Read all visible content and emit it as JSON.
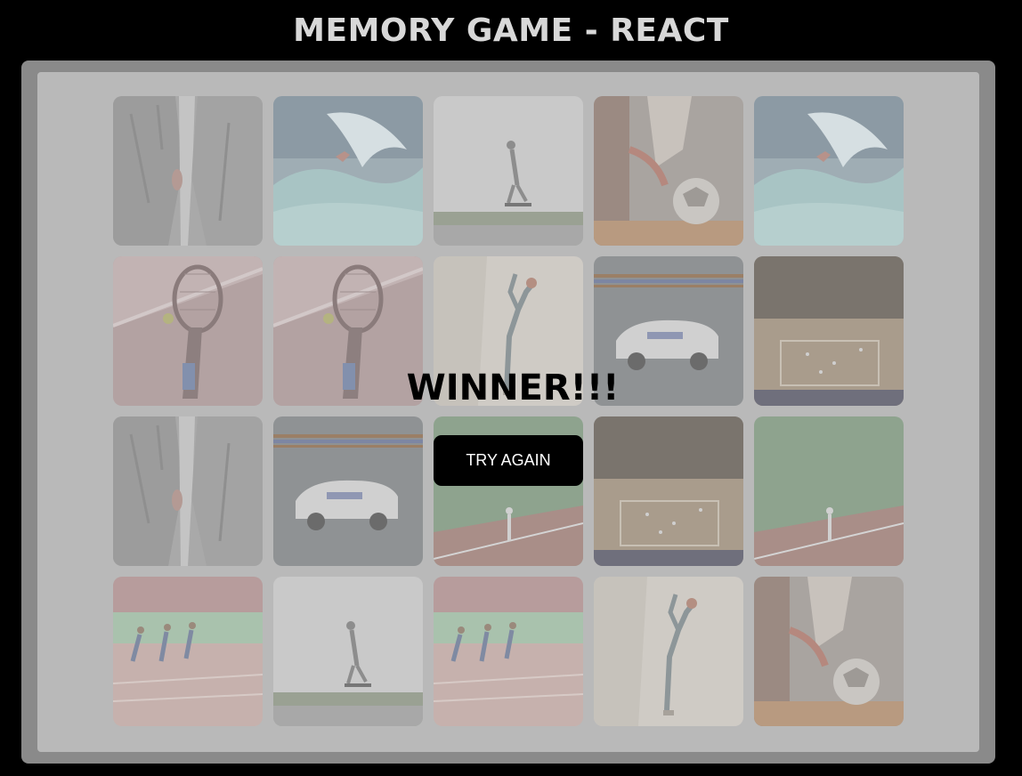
{
  "title": "MEMORY GAME - REACT",
  "result": {
    "message": "WINNER!!!",
    "button_label": "TRY AGAIN"
  },
  "cards": [
    {
      "image": "rock-climber"
    },
    {
      "image": "surfer-wave"
    },
    {
      "image": "skateboarder-jump"
    },
    {
      "image": "soccer-ball-kick"
    },
    {
      "image": "surfer-wave"
    },
    {
      "image": "tennis-racket"
    },
    {
      "image": "tennis-racket"
    },
    {
      "image": "yoga-pose"
    },
    {
      "image": "race-car"
    },
    {
      "image": "basketball-court"
    },
    {
      "image": "rock-climber"
    },
    {
      "image": "race-car"
    },
    {
      "image": "baseball-field"
    },
    {
      "image": "basketball-court"
    },
    {
      "image": "baseball-field"
    },
    {
      "image": "track-runners"
    },
    {
      "image": "skateboarder-jump"
    },
    {
      "image": "track-runners"
    },
    {
      "image": "yoga-pose"
    },
    {
      "image": "soccer-ball-kick"
    }
  ],
  "colors": {
    "background": "#000000",
    "board_frame": "#8a8a8a",
    "board_surface": "#b9b9b9",
    "title": "#d8d8d8",
    "button": "#000000",
    "button_text": "#ffffff"
  }
}
